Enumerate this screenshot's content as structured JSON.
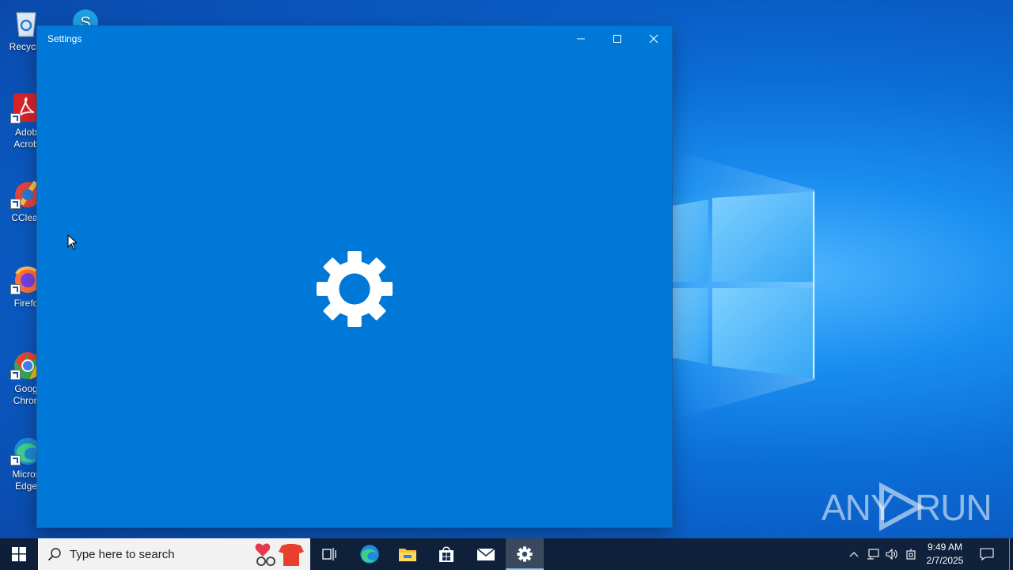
{
  "desktop": {
    "icons": [
      {
        "label": "Recycle",
        "icon": "recycle-bin-icon"
      },
      {
        "label": "Adob\nAcrob",
        "icon": "adobe-acrobat-icon"
      },
      {
        "label": "CClear",
        "icon": "ccleaner-icon"
      },
      {
        "label": "Firefo",
        "icon": "firefox-icon"
      },
      {
        "label": "Goog\nChron",
        "icon": "chrome-icon"
      },
      {
        "label": "Micros\nEdge",
        "icon": "edge-icon"
      }
    ],
    "watermark": {
      "left": "ANY",
      "right": "RUN"
    }
  },
  "window": {
    "title": "Settings",
    "controls": [
      "minimize",
      "maximize",
      "close"
    ],
    "splash_icon": "gear-icon",
    "accent": "#0078d7"
  },
  "taskbar": {
    "search_placeholder": "Type here to search",
    "pinned": [
      "task-view-icon",
      "edge-icon",
      "file-explorer-icon",
      "store-icon",
      "mail-icon",
      "settings-icon"
    ],
    "active": "settings-icon",
    "clock": {
      "time": "9:49 AM",
      "date": "2/7/2025"
    }
  }
}
